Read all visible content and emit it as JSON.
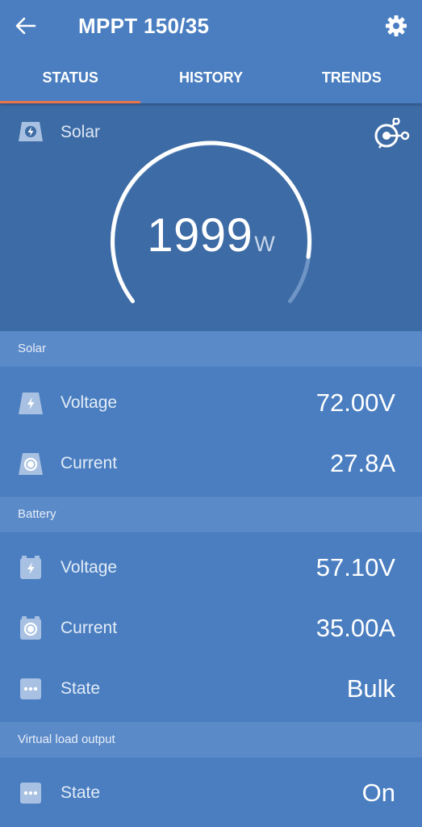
{
  "header": {
    "title": "MPPT 150/35",
    "back_icon": "arrow-left-icon",
    "settings_icon": "gear-icon"
  },
  "tabs": [
    {
      "label": "STATUS",
      "active": true
    },
    {
      "label": "HISTORY",
      "active": false
    },
    {
      "label": "TRENDS",
      "active": false
    }
  ],
  "gauge": {
    "label": "Solar",
    "value": "1999",
    "unit": "W",
    "icon": "solar-panel-icon",
    "network_icon": "network-link-icon"
  },
  "sections": {
    "solar": {
      "title": "Solar",
      "rows": [
        {
          "label": "Voltage",
          "value": "72.00V",
          "icon": "solar-voltage-icon"
        },
        {
          "label": "Current",
          "value": "27.8A",
          "icon": "solar-current-icon"
        }
      ]
    },
    "battery": {
      "title": "Battery",
      "rows": [
        {
          "label": "Voltage",
          "value": "57.10V",
          "icon": "battery-voltage-icon"
        },
        {
          "label": "Current",
          "value": "35.00A",
          "icon": "battery-current-icon"
        },
        {
          "label": "State",
          "value": "Bulk",
          "icon": "dots-icon"
        }
      ]
    },
    "load": {
      "title": "Virtual load output",
      "rows": [
        {
          "label": "State",
          "value": "On",
          "icon": "dots-icon"
        }
      ]
    }
  },
  "colors": {
    "background": "#4a7ec0",
    "gauge_panel": "#3d6ba5",
    "section_header": "#5b8ac9",
    "tab_indicator": "#e8764a"
  }
}
